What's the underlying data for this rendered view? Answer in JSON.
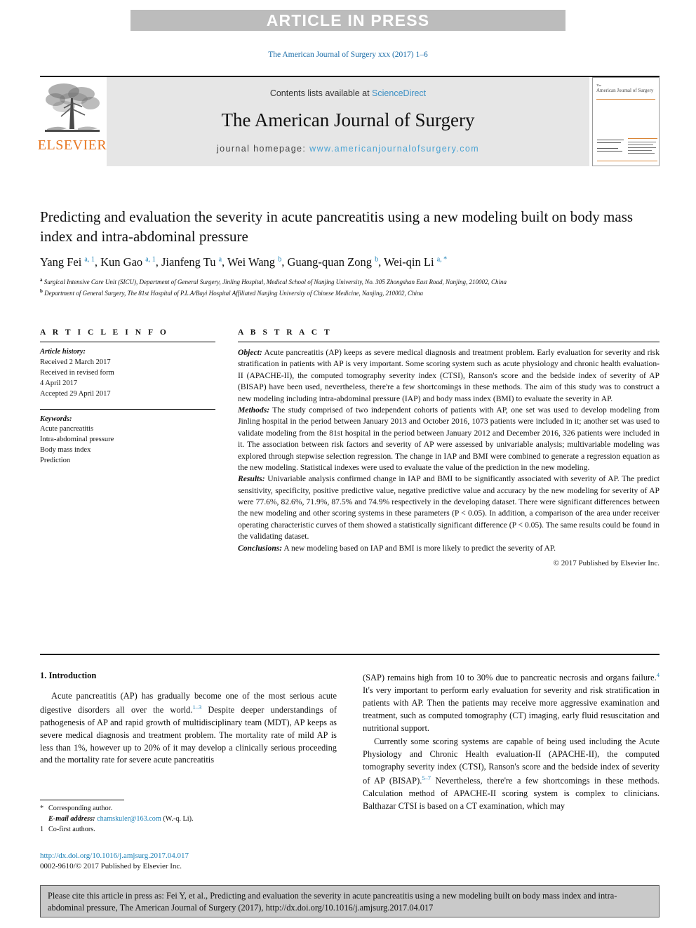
{
  "banner": {
    "text": "ARTICLE IN PRESS"
  },
  "journal_ref": "The American Journal of Surgery xxx (2017) 1–6",
  "masthead": {
    "contents_prefix": "Contents lists available at ",
    "sciencedirect": "ScienceDirect",
    "journal_title": "The American Journal of Surgery",
    "homepage_label": "journal homepage: ",
    "homepage_url": "www.americanjournalofsurgery.com",
    "elsevier_wordmark": "ELSEVIER",
    "cover_title_small": "The",
    "cover_title": "American Journal of Surgery"
  },
  "article": {
    "title": "Predicting and evaluation the severity in acute pancreatitis using a new modeling built on body mass index and intra-abdominal pressure",
    "authors_html": "Yang Fei <sup>a, 1</sup>, Kun Gao <sup>a, 1</sup>, Jianfeng Tu <sup>a</sup>, Wei Wang <sup>b</sup>, Guang-quan Zong <sup>b</sup>, Wei-qin Li <sup>a, *</sup>",
    "affiliation_a": "Surgical Intensive Care Unit (SICU), Department of General Surgery, Jinling Hospital, Medical School of Nanjing University, No. 305 Zhongshan East Road, Nanjing, 210002, China",
    "affiliation_b": "Department of General Surgery, The 81st Hospital of P.L.A/Bayi Hospital Affiliated Nanjing University of Chinese Medicine, Nanjing, 210002, China"
  },
  "article_info": {
    "heading": "A R T I C L E   I N F O",
    "history_label": "Article history:",
    "history": [
      "Received 2 March 2017",
      "Received in revised form",
      "4 April 2017",
      "Accepted 29 April 2017"
    ],
    "keywords_label": "Keywords:",
    "keywords": [
      "Acute pancreatitis",
      "Intra-abdominal pressure",
      "Body mass index",
      "Prediction"
    ]
  },
  "abstract": {
    "heading": "A B S T R A C T",
    "object_label": "Object:",
    "object_text": " Acute pancreatitis (AP) keeps as severe medical diagnosis and treatment problem. Early evaluation for severity and risk stratification in patients with AP is very important. Some scoring system such as acute physiology and chronic health evaluation-II (APACHE-II), the computed tomography severity index (CTSI), Ranson's score and the bedside index of severity of AP (BISAP) have been used, nevertheless, there're a few shortcomings in these methods. The aim of this study was to construct a new modeling including intra-abdominal pressure (IAP) and body mass index (BMI) to evaluate the severity in AP.",
    "methods_label": "Methods:",
    "methods_text": " The study comprised of two independent cohorts of patients with AP, one set was used to develop modeling from Jinling hospital in the period between January 2013 and October 2016, 1073 patients were included in it; another set was used to validate modeling from the 81st hospital in the period between January 2012 and December 2016, 326 patients were included in it. The association between risk factors and severity of AP were assessed by univariable analysis; multivariable modeling was explored through stepwise selection regression. The change in IAP and BMI were combined to generate a regression equation as the new modeling. Statistical indexes were used to evaluate the value of the prediction in the new modeling.",
    "results_label": "Results:",
    "results_text": " Univariable analysis confirmed change in IAP and BMI to be significantly associated with severity of AP. The predict sensitivity, specificity, positive predictive value, negative predictive value and accuracy by the new modeling for severity of AP were 77.6%, 82.6%, 71.9%, 87.5% and 74.9% respectively in the developing dataset. There were significant differences between the new modeling and other scoring systems in these parameters (P < 0.05). In addition, a comparison of the area under receiver operating characteristic curves of them showed a statistically significant difference (P < 0.05). The same results could be found in the validating dataset.",
    "conclusions_label": "Conclusions:",
    "conclusions_text": " A new modeling based on IAP and BMI is more likely to predict the severity of AP.",
    "copyright": "© 2017 Published by Elsevier Inc."
  },
  "introduction": {
    "heading": "1. Introduction",
    "para1_a": "Acute pancreatitis (AP) has gradually become one of the most serious acute digestive disorders all over the world.",
    "para1_ref": "1–3",
    "para1_b": " Despite deeper understandings of pathogenesis of AP and rapid growth of multidisciplinary team (MDT), AP keeps as severe medical diagnosis and treatment problem. The mortality rate of mild AP is less than 1%, however up to 20% of it may develop a clinically serious proceeding and the mortality rate for severe acute pancreatitis",
    "para2_a": "(SAP) remains high from 10 to 30% due to pancreatic necrosis and organs failure.",
    "para2_ref": "4",
    "para2_b": " It's very important to perform early evaluation for severity and risk stratification in patients with AP. Then the patients may receive more aggressive examination and treatment, such as computed tomography (CT) imaging, early fluid resuscitation and nutritional support.",
    "para3_a": "Currently some scoring systems are capable of being used including the Acute Physiology and Chronic Health evaluation-II (APACHE-II), the computed tomography severity index (CTSI), Ranson's score and the bedside index of severity of AP (BISAP).",
    "para3_ref": "5–7",
    "para3_b": " Nevertheless, there're a few shortcomings in these methods. Calculation method of APACHE-II scoring system is complex to clinicians. Balthazar CTSI is based on a CT examination, which may"
  },
  "footnotes": {
    "corresponding_mark": "*",
    "corresponding_text": "Corresponding author.",
    "email_label": "E-mail address:",
    "email": "chamskuler@163.com",
    "email_suffix": "(W.-q. Li).",
    "cofirst_mark": "1",
    "cofirst_text": "Co-first authors.",
    "doi": "http://dx.doi.org/10.1016/j.amjsurg.2017.04.017",
    "issn": "0002-9610/© 2017 Published by Elsevier Inc."
  },
  "citation_footer": {
    "text": "Please cite this article in press as: Fei Y, et al., Predicting and evaluation the severity in acute pancreatitis using a new modeling built on body mass index and intra-abdominal pressure, The American Journal of Surgery (2017), http://dx.doi.org/10.1016/j.amjsurg.2017.04.017"
  },
  "colors": {
    "banner_bg": "#bcbcbc",
    "link_blue": "#1a7fb5",
    "elsevier_orange": "#e87722",
    "masthead_gray": "#e6e6e6",
    "footer_gray": "#c9c9c9"
  }
}
